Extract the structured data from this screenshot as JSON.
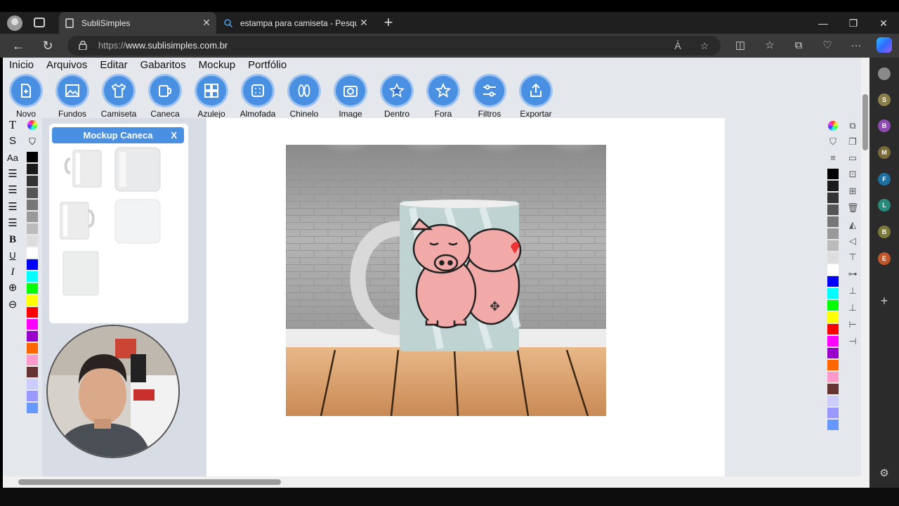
{
  "browser": {
    "tabs": [
      {
        "title": "SubliSimples",
        "active": true
      },
      {
        "title": "estampa para camiseta - Pesquisar",
        "active": false
      }
    ],
    "url_scheme": "https://",
    "url_host": "www.sublisimples.com.br"
  },
  "menu": [
    "Inicio",
    "Arquivos",
    "Editar",
    "Gabaritos",
    "Mockup",
    "Portfólio"
  ],
  "toolbar": [
    {
      "label": "Novo",
      "icon": "new-file-icon"
    },
    {
      "label": "Fundos",
      "icon": "image-icon"
    },
    {
      "label": "Camiseta",
      "icon": "tshirt-icon"
    },
    {
      "label": "Caneca",
      "icon": "mug-icon"
    },
    {
      "label": "Azulejo",
      "icon": "tile-grid-icon"
    },
    {
      "label": "Almofada",
      "icon": "cushion-icon"
    },
    {
      "label": "Chinelo",
      "icon": "flip-flop-icon"
    },
    {
      "label": "Image",
      "icon": "camera-icon"
    },
    {
      "label": "Dentro",
      "icon": "star-inside-icon"
    },
    {
      "label": "Fora",
      "icon": "star-outside-icon"
    },
    {
      "label": "Filtros",
      "icon": "sliders-icon"
    },
    {
      "label": "Exportar",
      "icon": "share-icon"
    }
  ],
  "mockup_panel": {
    "title": "Mockup Caneca",
    "close": "X"
  },
  "text_tools": {
    "text": "T",
    "font_size": "Aa",
    "bold": "B",
    "underline": "U",
    "italic": "I"
  },
  "colors": [
    "#000000",
    "#1a1a1a",
    "#333333",
    "#555555",
    "#777777",
    "#999999",
    "#bbbbbb",
    "#dddddd",
    "#ffffff",
    "#0000ff",
    "#00ffff",
    "#00ff00",
    "#ffff00",
    "#ff0000",
    "#ff00ff",
    "#9900cc",
    "#ff6600",
    "#ff99cc",
    "#663333",
    "#ccccff",
    "#9999ff",
    "#6699ff"
  ],
  "edge_sidebar": [
    "S",
    "B",
    "M",
    "F",
    "L",
    "B",
    "E"
  ],
  "accent": "#4a90e2"
}
